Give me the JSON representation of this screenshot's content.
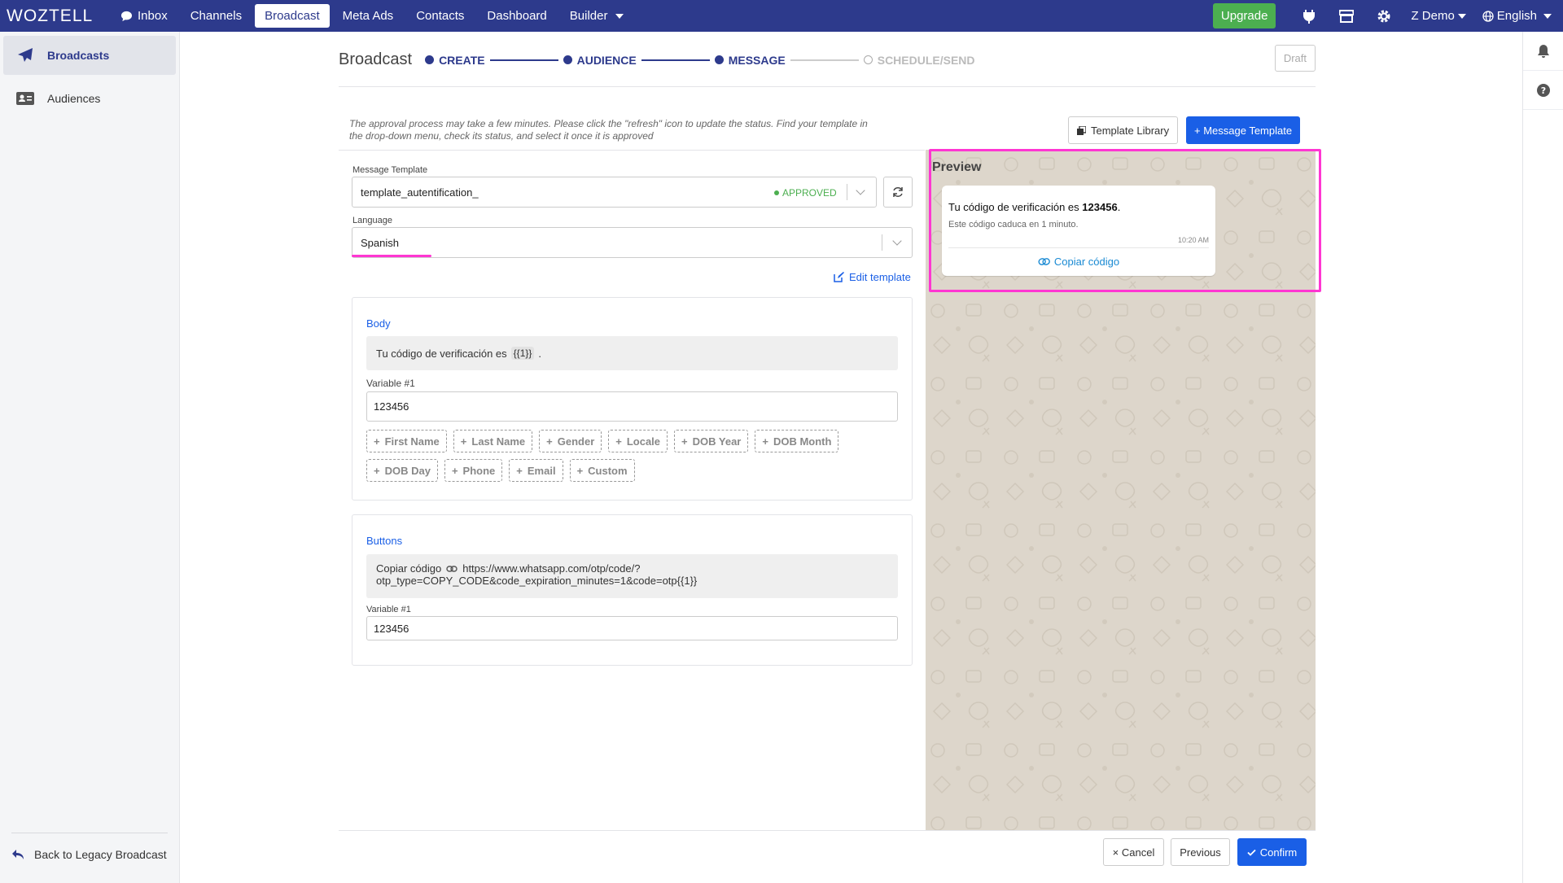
{
  "nav": {
    "logo": "WOZTELL",
    "items": [
      "Inbox",
      "Channels",
      "Broadcast",
      "Meta Ads",
      "Contacts",
      "Dashboard",
      "Builder"
    ],
    "upgrade": "Upgrade",
    "user": "Z Demo",
    "language": "English"
  },
  "sidebar": {
    "items": [
      "Broadcasts",
      "Audiences"
    ],
    "back": "Back to Legacy Broadcast"
  },
  "header": {
    "title": "Broadcast",
    "steps": [
      "CREATE",
      "AUDIENCE",
      "MESSAGE",
      "SCHEDULE/SEND"
    ],
    "draft": "Draft"
  },
  "info_text": "The approval process may take a few minutes. Please click the \"refresh\" icon to update the status. Find your template in the drop-down menu, check its status, and select it once it is approved",
  "buttons": {
    "template_library": "Template Library",
    "message_template": "+ Message Template",
    "edit_template": "Edit template",
    "cancel": "× Cancel",
    "previous": "Previous",
    "confirm": "Confirm"
  },
  "form": {
    "template_label": "Message Template",
    "template_value": "template_autentification_",
    "template_status": "APPROVED",
    "language_label": "Language",
    "language_value": "Spanish"
  },
  "body": {
    "title": "Body",
    "text": "Tu código de verificación es",
    "var_token": "{{1}}",
    "text_end": ".",
    "variable_label": "Variable #1",
    "variable_value": "123456",
    "chips": [
      "First Name",
      "Last Name",
      "Gender",
      "Locale",
      "DOB Year",
      "DOB Month",
      "DOB Day",
      "Phone",
      "Email",
      "Custom"
    ]
  },
  "buttons_section": {
    "title": "Buttons",
    "button_text": "Copiar código",
    "url_line1": "https://www.whatsapp.com/otp/code/?",
    "url_line2": "otp_type=COPY_CODE&code_expiration_minutes=1&code=otp{{1}}",
    "variable_label": "Variable #1",
    "variable_value": "123456"
  },
  "preview": {
    "title": "Preview",
    "message_prefix": "Tu código de verificación es",
    "code": "123456",
    "message_suffix": ".",
    "sub": "Este código caduca en 1 minuto.",
    "time": "10:20 AM",
    "button": "Copiar código"
  },
  "colors": {
    "nav": "#2d3a8c",
    "primary": "#1a5fe6",
    "approved": "#4caf50",
    "highlight": "#ff36d2",
    "preview_bg": "#ddd6cb"
  }
}
